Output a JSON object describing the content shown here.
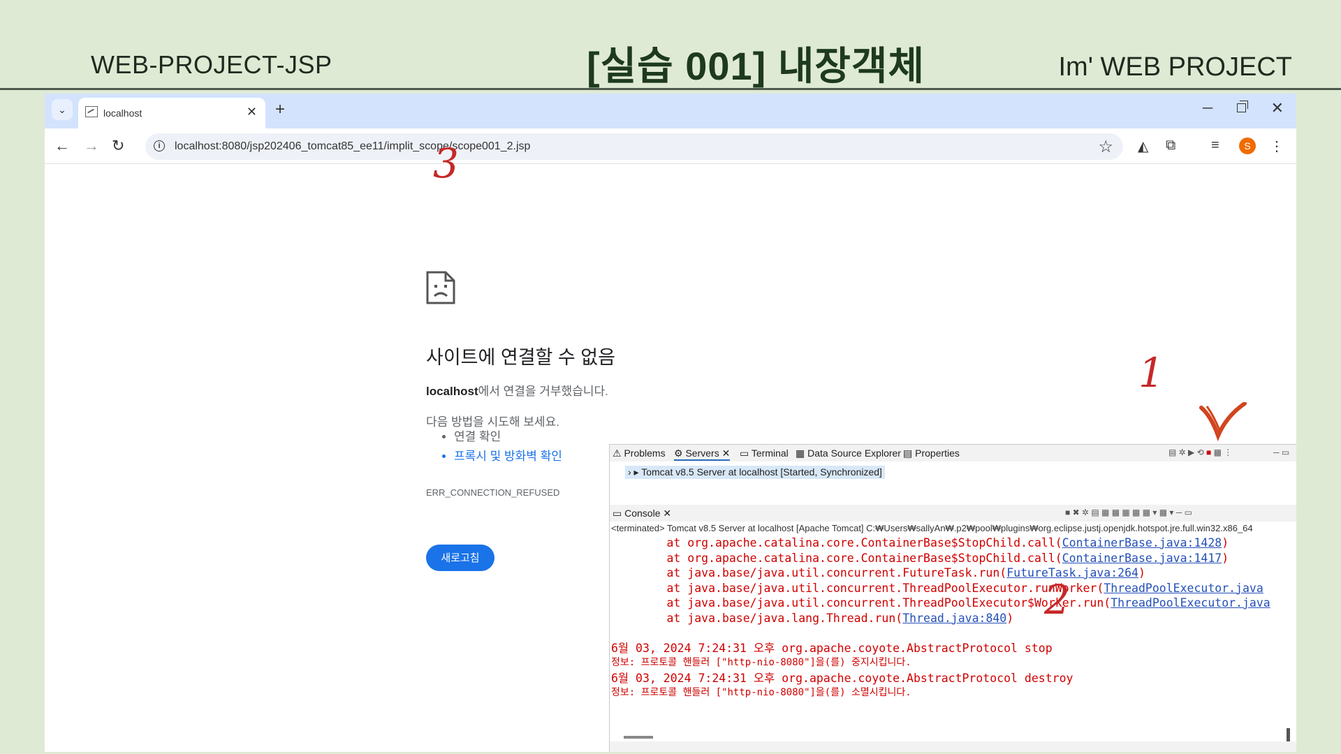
{
  "slide": {
    "left_label": "WEB-PROJECT-JSP",
    "title": "[실습 001] 내장객체",
    "right_label": "Im' WEB PROJECT"
  },
  "browser": {
    "tab_title": "localhost",
    "url": "localhost:8080/jsp202406_tomcat85_ee11/implit_scope/scope001_2.jsp",
    "profile_initial": "S"
  },
  "error_page": {
    "title": "사이트에 연결할 수 없음",
    "host": "localhost",
    "host_suffix": "에서 연결을 거부했습니다.",
    "try_label": "다음 방법을 시도해 보세요.",
    "suggestions": [
      "연결 확인",
      "프록시 및 방화벽 확인"
    ],
    "error_code": "ERR_CONNECTION_REFUSED",
    "reload_label": "새로고침"
  },
  "annotations": {
    "a1": "1",
    "a2": "2",
    "a3": "3"
  },
  "eclipse": {
    "tabs": [
      "Problems",
      "Servers",
      "Terminal",
      "Data Source Explorer",
      "Properties"
    ],
    "server_row": "Tomcat v8.5 Server at localhost  [Started, Synchronized]",
    "console_tab": "Console",
    "terminated": "<terminated> Tomcat v8.5 Server at localhost [Apache Tomcat] C:₩Users₩sallyAn₩.p2₩pool₩plugins₩org.eclipse.justj.openjdk.hotspot.jre.full.win32.x86_64",
    "stack": [
      {
        "prefix": "        at org.apache.catalina.core.ContainerBase$StopChild.call(",
        "link": "ContainerBase.java:1428",
        "suffix": ")"
      },
      {
        "prefix": "        at org.apache.catalina.core.ContainerBase$StopChild.call(",
        "link": "ContainerBase.java:1417",
        "suffix": ")"
      },
      {
        "prefix": "        at java.base/java.util.concurrent.FutureTask.run(",
        "link": "FutureTask.java:264",
        "suffix": ")"
      },
      {
        "prefix": "        at java.base/java.util.concurrent.ThreadPoolExecutor.runWorker(",
        "link": "ThreadPoolExecutor.java",
        "suffix": ""
      },
      {
        "prefix": "        at java.base/java.util.concurrent.ThreadPoolExecutor$Worker.run(",
        "link": "ThreadPoolExecutor.java",
        "suffix": ""
      },
      {
        "prefix": "        at java.base/java.lang.Thread.run(",
        "link": "Thread.java:840",
        "suffix": ")"
      }
    ],
    "log_lines": [
      "6월 03, 2024 7:24:31 오후 org.apache.coyote.AbstractProtocol stop",
      "정보: 프로토콜 핸들러 [\"http-nio-8080\"]을(를) 중지시킵니다.",
      "6월 03, 2024 7:24:31 오후 org.apache.coyote.AbstractProtocol destroy",
      "정보: 프로토콜 핸들러 [\"http-nio-8080\"]을(를) 소멸시킵니다."
    ]
  }
}
